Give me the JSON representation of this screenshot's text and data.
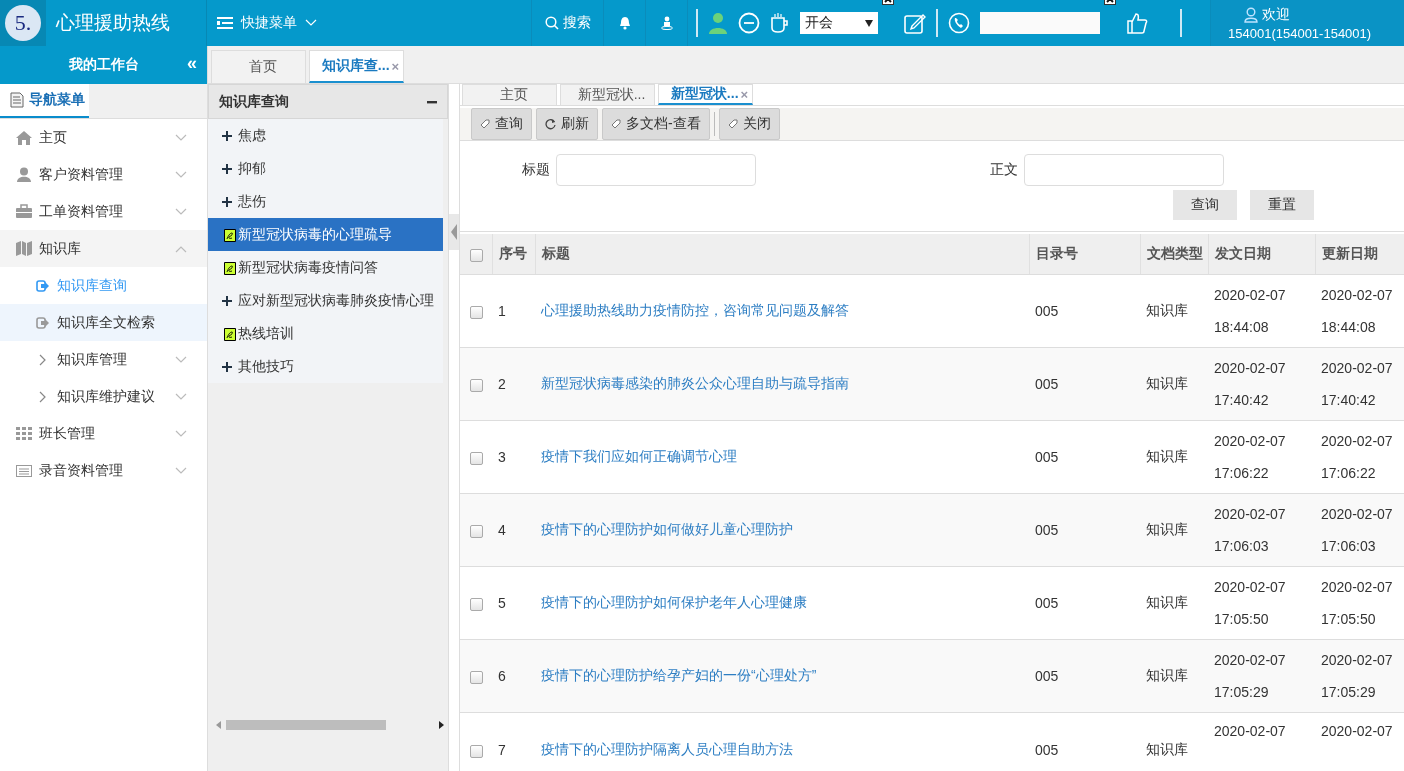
{
  "header": {
    "logo": "5.",
    "title": "心理援助热线",
    "quick_menu": "快捷菜单",
    "search": "搜索",
    "status_select": {
      "value": "开会"
    },
    "welcome": "欢迎",
    "user": "154001(154001-154001)"
  },
  "workbench": {
    "title": "我的工作台",
    "collapse": "«"
  },
  "outer_tabs": [
    {
      "label": "首页",
      "selected": false
    },
    {
      "label": "知识库查...",
      "selected": true,
      "close": "×"
    }
  ],
  "sidebar": {
    "tab": "导航菜单",
    "items": [
      {
        "label": "主页",
        "expanded": false
      },
      {
        "label": "客户资料管理",
        "expanded": false
      },
      {
        "label": "工单资料管理",
        "expanded": false
      },
      {
        "label": "知识库",
        "expanded": true,
        "children": [
          {
            "label": "知识库查询",
            "kind": "link",
            "selected": true,
            "highlighted": false
          },
          {
            "label": "知识库全文检索",
            "kind": "link",
            "selected": false,
            "highlighted": true
          },
          {
            "label": "知识库管理",
            "kind": "group",
            "selected": false,
            "highlighted": false
          },
          {
            "label": "知识库维护建议",
            "kind": "group",
            "selected": false,
            "highlighted": false
          }
        ]
      },
      {
        "label": "班长管理",
        "expanded": false
      },
      {
        "label": "录音资料管理",
        "expanded": false
      }
    ]
  },
  "tree": {
    "title": "知识库查询",
    "items": [
      {
        "label": "焦虑",
        "kind": "folder",
        "selected": false
      },
      {
        "label": "抑郁",
        "kind": "folder",
        "selected": false
      },
      {
        "label": "悲伤",
        "kind": "folder",
        "selected": false
      },
      {
        "label": "新型冠状病毒的心理疏导",
        "kind": "doc",
        "selected": true
      },
      {
        "label": "新型冠状病毒疫情问答",
        "kind": "doc",
        "selected": false
      },
      {
        "label": "应对新型冠状病毒肺炎疫情心理",
        "kind": "folder",
        "selected": false
      },
      {
        "label": "热线培训",
        "kind": "doc",
        "selected": false
      },
      {
        "label": "其他技巧",
        "kind": "folder",
        "selected": false
      }
    ]
  },
  "inner_tabs": [
    {
      "label": "主页",
      "selected": false
    },
    {
      "label": "新型冠状...",
      "selected": false
    },
    {
      "label": "新型冠状...",
      "selected": true,
      "close": "×"
    }
  ],
  "toolbar": [
    {
      "label": "查询"
    },
    {
      "label": "刷新"
    },
    {
      "label": "多文档-查看"
    },
    {
      "label": "关闭"
    }
  ],
  "search_form": {
    "fields": [
      {
        "label": "标题"
      },
      {
        "label": "正文"
      }
    ],
    "buttons": [
      "查询",
      "重置"
    ]
  },
  "table": {
    "select_all": {
      "checked": false
    },
    "columns": [
      "序号",
      "标题",
      "目录号",
      "文档类型",
      "发文日期",
      "更新日期"
    ],
    "rows": [
      {
        "checked": false,
        "no": "1",
        "title": "心理援助热线助力疫情防控，咨询常见问题及解答",
        "catalog": "005",
        "type": "知识库",
        "issued_date": "2020-02-07",
        "issued_time": "18:44:08",
        "updated_date": "2020-02-07",
        "updated_time": "18:44:08"
      },
      {
        "checked": false,
        "no": "2",
        "title": "新型冠状病毒感染的肺炎公众心理自助与疏导指南",
        "catalog": "005",
        "type": "知识库",
        "issued_date": "2020-02-07",
        "issued_time": "17:40:42",
        "updated_date": "2020-02-07",
        "updated_time": "17:40:42"
      },
      {
        "checked": false,
        "no": "3",
        "title": "疫情下我们应如何正确调节心理",
        "catalog": "005",
        "type": "知识库",
        "issued_date": "2020-02-07",
        "issued_time": "17:06:22",
        "updated_date": "2020-02-07",
        "updated_time": "17:06:22"
      },
      {
        "checked": false,
        "no": "4",
        "title": "疫情下的心理防护如何做好儿童心理防护",
        "catalog": "005",
        "type": "知识库",
        "issued_date": "2020-02-07",
        "issued_time": "17:06:03",
        "updated_date": "2020-02-07",
        "updated_time": "17:06:03"
      },
      {
        "checked": false,
        "no": "5",
        "title": "疫情下的心理防护如何保护老年人心理健康",
        "catalog": "005",
        "type": "知识库",
        "issued_date": "2020-02-07",
        "issued_time": "17:05:50",
        "updated_date": "2020-02-07",
        "updated_time": "17:05:50"
      },
      {
        "checked": false,
        "no": "6",
        "title": "疫情下的心理防护给孕产妇的一份“心理处方”",
        "catalog": "005",
        "type": "知识库",
        "issued_date": "2020-02-07",
        "issued_time": "17:05:29",
        "updated_date": "2020-02-07",
        "updated_time": "17:05:29"
      },
      {
        "checked": false,
        "no": "7",
        "title": "疫情下的心理防护隔离人员心理自助方法",
        "catalog": "005",
        "type": "知识库",
        "issued_date": "2020-02-07",
        "updated_date": "2020-02-07"
      }
    ]
  }
}
